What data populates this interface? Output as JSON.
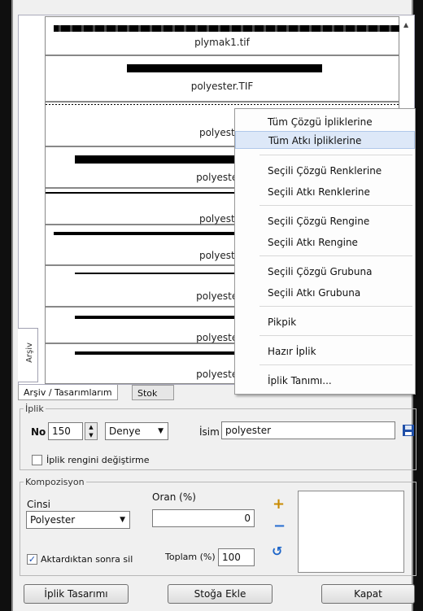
{
  "archive": {
    "side_tab": "Arşiv",
    "yarns": [
      {
        "name": "plymak1.tif",
        "style": "texture"
      },
      {
        "name": "polyester.TIF",
        "style": "thick"
      },
      {
        "name": "polyester",
        "style": "dotted"
      },
      {
        "name": "polyester1",
        "style": "thick"
      },
      {
        "name": "polyester",
        "style": "thin"
      },
      {
        "name": "polyester",
        "style": "medium"
      },
      {
        "name": "polyester3",
        "style": "thin"
      },
      {
        "name": "polyester4",
        "style": "medium"
      },
      {
        "name": "polyester5",
        "style": "medium"
      },
      {
        "name": "",
        "style": "thick"
      }
    ]
  },
  "tabs": {
    "active": "Arşiv / Tasarımlarım",
    "inactive": "Stok"
  },
  "iplik": {
    "legend": "İplik",
    "no_label": "No",
    "no_value": "150",
    "unit": "Denye",
    "isim_label": "İsim",
    "isim_value": "polyester",
    "keep_color_label": "İplik rengini değiştirme",
    "keep_color_checked": false
  },
  "kompozisyon": {
    "legend": "Kompozisyon",
    "cinsi_label": "Cinsi",
    "cinsi_value": "Polyester",
    "oran_label": "Oran (%)",
    "oran_value": "0",
    "delete_after_label": "Aktardıktan sonra sil",
    "delete_after_checked": true,
    "toplam_label": "Toplam (%)",
    "toplam_value": "100"
  },
  "buttons": {
    "design": "İplik Tasarımı",
    "add_stock": "Stoğa Ekle",
    "close": "Kapat"
  },
  "context_menu": {
    "items": [
      "Tüm Çözgü İpliklerine",
      "Tüm Atkı İpliklerine",
      "Seçili Çözgü Renklerine",
      "Seçili Atkı Renklerine",
      "Seçili Çözgü Rengine",
      "Seçili Atkı Rengine",
      "Seçili Çözgü Grubuna",
      "Seçili Atkı Grubuna",
      "Pikpik",
      "Hazır İplik",
      "İplik Tanımı..."
    ],
    "highlighted_index": 1
  },
  "colors": {
    "add": "#c98a00",
    "remove": "#2a6fd1",
    "undo": "#1e66c9",
    "save": "#1f4fa8"
  }
}
